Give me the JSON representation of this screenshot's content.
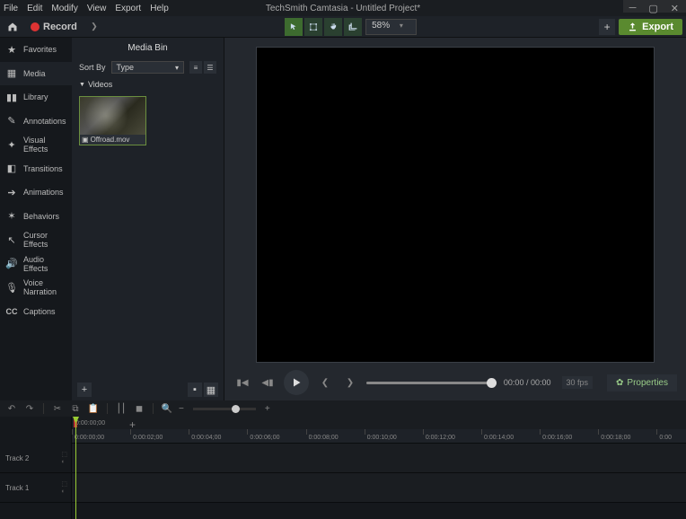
{
  "menu": {
    "items": [
      "File",
      "Edit",
      "Modify",
      "View",
      "Export",
      "Help"
    ]
  },
  "title": "TechSmith Camtasia - Untitled Project*",
  "toolbar": {
    "record_label": "Record",
    "zoom_value": "58%",
    "export_label": "Export"
  },
  "sidebar": {
    "items": [
      {
        "icon": "star",
        "label": "Favorites"
      },
      {
        "icon": "film",
        "label": "Media"
      },
      {
        "icon": "books",
        "label": "Library"
      },
      {
        "icon": "note",
        "label": "Annotations"
      },
      {
        "icon": "wand",
        "label": "Visual Effects"
      },
      {
        "icon": "trans",
        "label": "Transitions"
      },
      {
        "icon": "anim",
        "label": "Animations"
      },
      {
        "icon": "behav",
        "label": "Behaviors"
      },
      {
        "icon": "cursor",
        "label": "Cursor Effects"
      },
      {
        "icon": "audio",
        "label": "Audio Effects"
      },
      {
        "icon": "mic",
        "label": "Voice Narration"
      },
      {
        "icon": "cc",
        "label": "Captions"
      }
    ]
  },
  "panel": {
    "title": "Media Bin",
    "sort_label": "Sort By",
    "sort_value": "Type",
    "section": "Videos",
    "clip_name": "Offroad.mov"
  },
  "playback": {
    "time_current": "00:00",
    "time_total": "00:00",
    "fps": "30 fps",
    "properties_label": "Properties"
  },
  "timeline": {
    "header_time": "0:00:00;00",
    "ticks": [
      "0:00:00;00",
      "0:00:02;00",
      "0:00:04;00",
      "0:00:06;00",
      "0:00:08;00",
      "0:00:10;00",
      "0:00:12;00",
      "0:00:14;00",
      "0:00:16;00",
      "0:00:18;00",
      "0:00"
    ],
    "tracks": [
      "Track 2",
      "Track 1"
    ]
  }
}
